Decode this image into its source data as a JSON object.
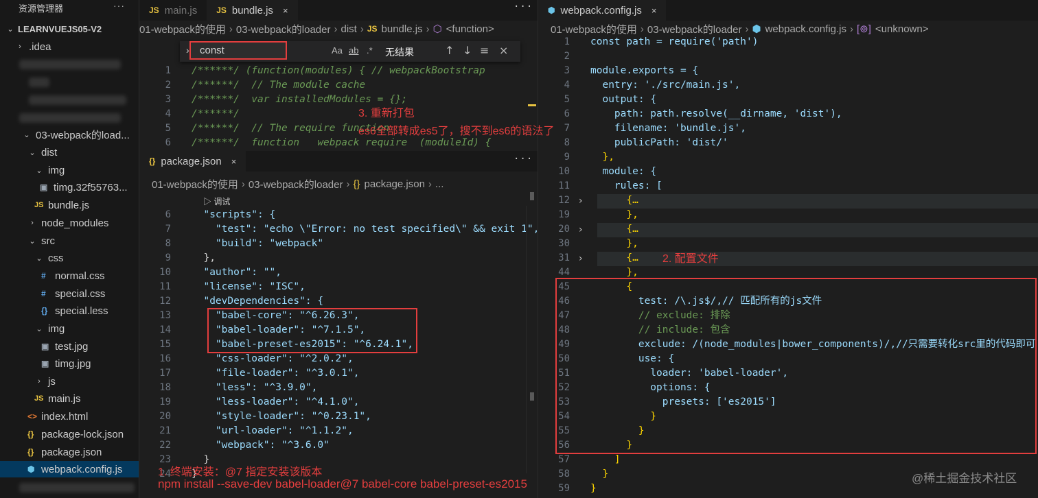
{
  "sidebar": {
    "title": "资源管理器",
    "more": "···",
    "root": "LEARNVUEJS05-V2",
    "items": [
      {
        "label": ".idea"
      },
      {
        "label": "03-webpack的load..."
      },
      {
        "label": "dist"
      },
      {
        "label": "img"
      },
      {
        "label": "timg.32f55763..."
      },
      {
        "label": "bundle.js"
      },
      {
        "label": "node_modules"
      },
      {
        "label": "src"
      },
      {
        "label": "css"
      },
      {
        "label": "normal.css"
      },
      {
        "label": "special.css"
      },
      {
        "label": "special.less"
      },
      {
        "label": "img"
      },
      {
        "label": "test.jpg"
      },
      {
        "label": "timg.jpg"
      },
      {
        "label": "js"
      },
      {
        "label": "main.js"
      },
      {
        "label": "index.html"
      },
      {
        "label": "package-lock.json"
      },
      {
        "label": "package.json"
      },
      {
        "label": "webpack.config.js"
      }
    ],
    "icons": {
      "js": "JS",
      "css": "#",
      "json": "{}",
      "html": "<>",
      "img": "▣",
      "cfg": "⬢"
    }
  },
  "tabs_left": {
    "main": "main.js",
    "bundle": "bundle.js",
    "close": "×",
    "more": "···"
  },
  "tabs_right": {
    "config": "webpack.config.js",
    "close": "×",
    "more": "···"
  },
  "tabs_pkg": {
    "package": "package.json",
    "close": "×",
    "more": "···"
  },
  "crumbs_bundle": [
    "01-webpack的使用",
    "03-webpack的loader",
    "dist",
    "bundle.js",
    "<function>"
  ],
  "crumbs_pkg": [
    "01-webpack的使用",
    "03-webpack的loader",
    "package.json",
    "..."
  ],
  "crumbs_config": [
    "01-webpack的使用",
    "03-webpack的loader",
    "webpack.config.js",
    "<unknown>"
  ],
  "find": {
    "query": "const",
    "opt_case": "Aa",
    "opt_word": "ab",
    "opt_regex": ".*",
    "result": "无结果",
    "prev": "↑",
    "next": "↓",
    "menu": "≡",
    "close": "×"
  },
  "debug_hint": "▷ 调试",
  "annotations": {
    "a1": "1. 终端安装：@7 指定安装该版本",
    "a1b": "npm install --save-dev babel-loader@7 babel-core babel-preset-es2015",
    "a2": "2. 配置文件",
    "a3": "3. 重新打包",
    "a3b": "es6全部转成es5了，搜不到es6的语法了"
  },
  "bundle_code": [
    {
      "n": "1",
      "t": "/******/ (function(modules) { // webpackBootstrap"
    },
    {
      "n": "2",
      "t": "/******/  // The module cache"
    },
    {
      "n": "3",
      "t": "/******/  var installedModules = {};"
    },
    {
      "n": "4",
      "t": "/******/"
    },
    {
      "n": "5",
      "t": "/******/  // The require function"
    },
    {
      "n": "6",
      "t": "/******/  function   webpack require  (moduleId) {"
    }
  ],
  "pkg_code": [
    {
      "n": "6",
      "t": "  \"scripts\": {"
    },
    {
      "n": "7",
      "t": "    \"test\": \"echo \\\"Error: no test specified\\\" && exit 1\","
    },
    {
      "n": "8",
      "t": "    \"build\": \"webpack\""
    },
    {
      "n": "9",
      "t": "  },"
    },
    {
      "n": "10",
      "t": "  \"author\": \"\","
    },
    {
      "n": "11",
      "t": "  \"license\": \"ISC\","
    },
    {
      "n": "12",
      "t": "  \"devDependencies\": {"
    },
    {
      "n": "13",
      "t": "    \"babel-core\": \"^6.26.3\","
    },
    {
      "n": "14",
      "t": "    \"babel-loader\": \"^7.1.5\","
    },
    {
      "n": "15",
      "t": "    \"babel-preset-es2015\": \"^6.24.1\","
    },
    {
      "n": "16",
      "t": "    \"css-loader\": \"^2.0.2\","
    },
    {
      "n": "17",
      "t": "    \"file-loader\": \"^3.0.1\","
    },
    {
      "n": "18",
      "t": "    \"less\": \"^3.9.0\","
    },
    {
      "n": "19",
      "t": "    \"less-loader\": \"^4.1.0\","
    },
    {
      "n": "20",
      "t": "    \"style-loader\": \"^0.23.1\","
    },
    {
      "n": "21",
      "t": "    \"url-loader\": \"^1.1.2\","
    },
    {
      "n": "22",
      "t": "    \"webpack\": \"^3.6.0\""
    },
    {
      "n": "23",
      "t": "  }"
    },
    {
      "n": "24",
      "t": "}"
    }
  ],
  "config_code": [
    {
      "n": "1",
      "t": "const path = require('path')"
    },
    {
      "n": "2",
      "t": ""
    },
    {
      "n": "3",
      "t": "module.exports = {"
    },
    {
      "n": "4",
      "t": "  entry: './src/main.js',"
    },
    {
      "n": "5",
      "t": "  output: {"
    },
    {
      "n": "6",
      "t": "    path: path.resolve(__dirname, 'dist'),"
    },
    {
      "n": "7",
      "t": "    filename: 'bundle.js',"
    },
    {
      "n": "8",
      "t": "    publicPath: 'dist/'"
    },
    {
      "n": "9",
      "t": "  },"
    },
    {
      "n": "10",
      "t": "  module: {"
    },
    {
      "n": "11",
      "t": "    rules: ["
    },
    {
      "n": "12",
      "t": "      {…"
    },
    {
      "n": "19",
      "t": "      },"
    },
    {
      "n": "20",
      "t": "      {…"
    },
    {
      "n": "30",
      "t": "      },"
    },
    {
      "n": "31",
      "t": "      {…"
    },
    {
      "n": "44",
      "t": "      },"
    },
    {
      "n": "45",
      "t": "      {"
    },
    {
      "n": "46",
      "t": "        test: /\\.js$/,// 匹配所有的js文件"
    },
    {
      "n": "47",
      "t": "        // exclude: 排除"
    },
    {
      "n": "48",
      "t": "        // include: 包含"
    },
    {
      "n": "49",
      "t": "        exclude: /(node_modules|bower_components)/,//只需要转化src里的代码即可"
    },
    {
      "n": "50",
      "t": "        use: {"
    },
    {
      "n": "51",
      "t": "          loader: 'babel-loader',"
    },
    {
      "n": "52",
      "t": "          options: {"
    },
    {
      "n": "53",
      "t": "            presets: ['es2015']"
    },
    {
      "n": "54",
      "t": "          }"
    },
    {
      "n": "55",
      "t": "        }"
    },
    {
      "n": "56",
      "t": "      }"
    },
    {
      "n": "57",
      "t": "    ]"
    },
    {
      "n": "58",
      "t": "  }"
    },
    {
      "n": "59",
      "t": "}"
    }
  ],
  "watermark": "@稀土掘金技术社区"
}
